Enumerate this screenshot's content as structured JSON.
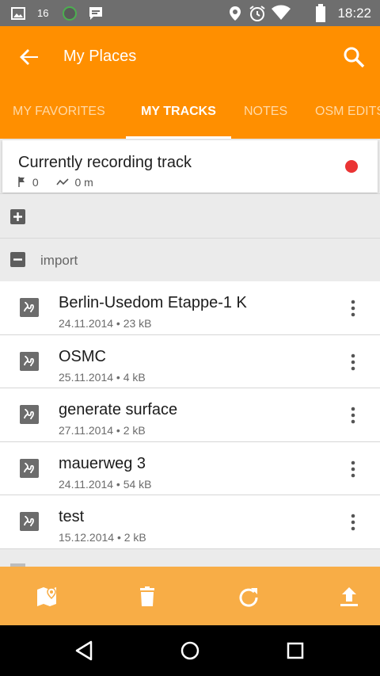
{
  "status_bar": {
    "time": "18:22",
    "notification_badge": "16",
    "icons": [
      "image-icon",
      "notification-count-icon",
      "app-round-icon",
      "message-icon",
      "location-pin-icon",
      "alarm-icon",
      "wifi-icon",
      "battery-icon"
    ]
  },
  "app_bar": {
    "title": "My Places",
    "back_icon": "arrow-back-icon",
    "search_icon": "search-icon"
  },
  "tabs": [
    {
      "label": "MY FAVORITES",
      "active": false
    },
    {
      "label": "MY TRACKS",
      "active": true
    },
    {
      "label": "NOTES",
      "active": false
    },
    {
      "label": "OSM EDITS",
      "active": false
    }
  ],
  "recording": {
    "title": "Currently recording track",
    "points": "0",
    "distance": "0 m",
    "status_color": "#ea3434"
  },
  "groups": [
    {
      "label": "",
      "expanded": false
    },
    {
      "label": "import",
      "expanded": true
    }
  ],
  "tracks": [
    {
      "name": "Berlin-Usedom Etappe-1 K",
      "subtitle": "24.11.2014 • 23 kB"
    },
    {
      "name": "OSMC",
      "subtitle": "25.11.2014 • 4 kB"
    },
    {
      "name": "generate surface",
      "subtitle": "27.11.2014 • 2 kB"
    },
    {
      "name": "mauerweg 3",
      "subtitle": "24.11.2014 • 54 kB"
    },
    {
      "name": "test",
      "subtitle": "15.12.2014 • 2 kB"
    }
  ],
  "toolbar": {
    "buttons": [
      "map-marker-icon",
      "delete-icon",
      "refresh-icon",
      "upload-icon"
    ]
  },
  "navigation": {
    "buttons": [
      "back-triangle-icon",
      "home-circle-icon",
      "recents-square-icon"
    ]
  },
  "colors": {
    "accent": "#ff8f00",
    "toolbar": "#f8ad46",
    "recording_dot": "#ea3434"
  }
}
